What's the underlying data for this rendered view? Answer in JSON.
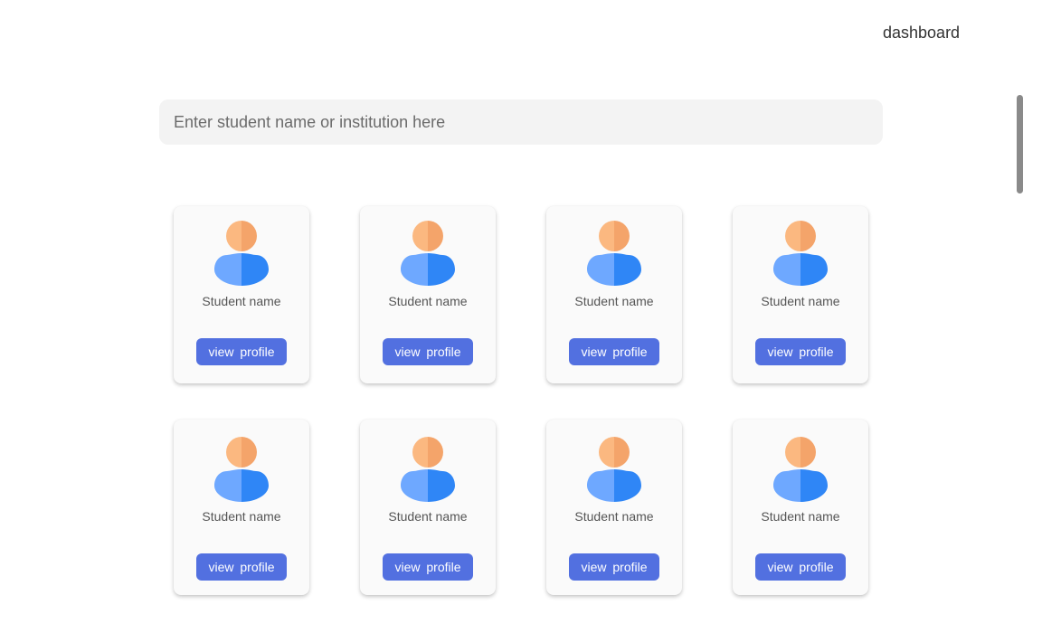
{
  "nav": {
    "dashboard_label": "dashboard"
  },
  "search": {
    "placeholder": "Enter student name or institution here",
    "value": ""
  },
  "colors": {
    "button": "#5270e0",
    "avatar_head_light": "#fbb880",
    "avatar_head_dark": "#f4a46a",
    "avatar_body_light": "#6ea8ff",
    "avatar_body_dark": "#2f86f6"
  },
  "cards": [
    {
      "name": "Student name",
      "button_label": "view  profile",
      "icon": "user-avatar-icon"
    },
    {
      "name": "Student name",
      "button_label": "view  profile",
      "icon": "user-avatar-icon"
    },
    {
      "name": "Student name",
      "button_label": "view  profile",
      "icon": "user-avatar-icon"
    },
    {
      "name": "Student name",
      "button_label": "view  profile",
      "icon": "user-avatar-icon"
    },
    {
      "name": "Student name",
      "button_label": "view  profile",
      "icon": "user-avatar-icon"
    },
    {
      "name": "Student name",
      "button_label": "view  profile",
      "icon": "user-avatar-icon"
    },
    {
      "name": "Student name",
      "button_label": "view  profile",
      "icon": "user-avatar-icon"
    },
    {
      "name": "Student name",
      "button_label": "view  profile",
      "icon": "user-avatar-icon"
    }
  ]
}
